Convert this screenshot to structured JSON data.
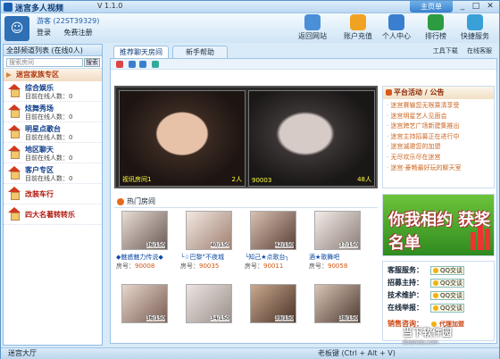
{
  "window": {
    "title": "迷宫多人视频",
    "version": "V 1.1.0",
    "top_link": "主页单"
  },
  "user": {
    "name": "游客 (22ST39329)",
    "login": "登录",
    "register": "免费注册"
  },
  "toolbar": [
    {
      "label": "返回网站",
      "color": "#4a8fd8"
    },
    {
      "label": "账户充值",
      "color": "#f0a323"
    },
    {
      "label": "个人中心",
      "color": "#3a7fcf"
    },
    {
      "label": "排行榜",
      "color": "#2d9b42"
    },
    {
      "label": "快捷服务",
      "color": "#3aa0d8"
    }
  ],
  "left": {
    "header": "全部频道列表  (在线0人)",
    "search_placeholder": "搜索房间",
    "search_button": "搜索",
    "zone": "迷宫家族专区",
    "channels": [
      {
        "name": "综合娱乐",
        "sub": "目前在线人数：0"
      },
      {
        "name": "炫舞秀场",
        "sub": "目前在线人数：0"
      },
      {
        "name": "明星点歌台",
        "sub": "目前在线人数：0"
      },
      {
        "name": "地区聊天",
        "sub": "目前在线人数：0"
      },
      {
        "name": "客户专区",
        "sub": "目前在线人数：0"
      }
    ],
    "extra": [
      "改装车行",
      "四大名著转转乐"
    ]
  },
  "tabs": [
    "推荐聊天房间",
    "新手帮助"
  ],
  "right_tools": [
    "工具下载",
    "在线客服"
  ],
  "featured": [
    {
      "caption": "视讯房间1",
      "count": "2人"
    },
    {
      "caption": "90003",
      "count": "48人"
    }
  ],
  "notice": {
    "title": "平台活动 / 公告",
    "items": [
      "迷宫赛输您无限乘清享受",
      "迷宫明星艺人见面会",
      "迷宫跨艺广场新建集推出",
      "迷宫主持招募正在进行中",
      "迷宫诚邀您的加盟",
      "无尽欢乐尽在迷宫",
      "迷宫·豪畅最好玩的聊天室"
    ]
  },
  "hot": {
    "title": "热门房间",
    "rooms": [
      {
        "count": "36/150",
        "name": "◆魅惑魅力传说◆",
        "no_label": "房号：",
        "no": "90008"
      },
      {
        "count": "40/150",
        "name": "╰☆巴黎°不夜城",
        "no_label": "房号：",
        "no": "90035"
      },
      {
        "count": "42/150",
        "name": "╰知己★点歌台╮",
        "no_label": "房号：",
        "no": "90011"
      },
      {
        "count": "37/150",
        "name": "酒★歌舞吧",
        "no_label": "房号：",
        "no": "90058"
      },
      {
        "count": "36/150",
        "name": "",
        "no_label": "",
        "no": ""
      },
      {
        "count": "34/150",
        "name": "",
        "no_label": "",
        "no": ""
      },
      {
        "count": "39/150",
        "name": "",
        "no_label": "",
        "no": ""
      },
      {
        "count": "38/150",
        "name": "",
        "no_label": "",
        "no": ""
      }
    ]
  },
  "banner": {
    "text": "你我相约 获奖名单"
  },
  "service": [
    {
      "label": "客服服务：",
      "qq": "QQ交谈"
    },
    {
      "label": "招募主持：",
      "qq": "QQ交谈"
    },
    {
      "label": "技术维护：",
      "qq": "QQ交谈"
    },
    {
      "label": "在线举报：",
      "qq": "QQ交谈"
    }
  ],
  "sales": {
    "label": "销售咨询：",
    "text": "代理加盟"
  },
  "status": {
    "left": "迷宫大厅",
    "right": "老板键 (Ctrl + Alt + V)"
  },
  "watermark": {
    "big": "当下软件园",
    "small": "downxia.com"
  }
}
